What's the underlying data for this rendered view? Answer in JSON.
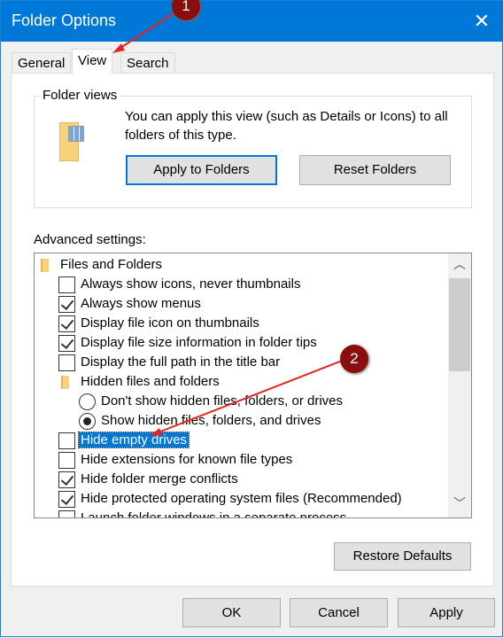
{
  "window": {
    "title": "Folder Options",
    "close_icon": "close-icon"
  },
  "tabs": [
    {
      "label": "General"
    },
    {
      "label": "View",
      "active": true
    },
    {
      "label": "Search"
    }
  ],
  "folder_views": {
    "label": "Folder views",
    "description": "You can apply this view (such as Details or Icons) to all folders of this type.",
    "apply_button": "Apply to Folders",
    "reset_button": "Reset Folders"
  },
  "advanced": {
    "label": "Advanced settings:",
    "items": [
      {
        "type": "folder",
        "label": "Files and Folders",
        "level": 0
      },
      {
        "type": "checkbox",
        "label": "Always show icons, never thumbnails",
        "checked": false
      },
      {
        "type": "checkbox",
        "label": "Always show menus",
        "checked": true
      },
      {
        "type": "checkbox",
        "label": "Display file icon on thumbnails",
        "checked": true
      },
      {
        "type": "checkbox",
        "label": "Display file size information in folder tips",
        "checked": true
      },
      {
        "type": "checkbox",
        "label": "Display the full path in the title bar",
        "checked": false
      },
      {
        "type": "folder",
        "label": "Hidden files and folders",
        "level": 1
      },
      {
        "type": "radio",
        "label": "Don't show hidden files, folders, or drives",
        "checked": false
      },
      {
        "type": "radio",
        "label": "Show hidden files, folders, and drives",
        "checked": true
      },
      {
        "type": "checkbox",
        "label": "Hide empty drives",
        "checked": false,
        "selected": true
      },
      {
        "type": "checkbox",
        "label": "Hide extensions for known file types",
        "checked": false
      },
      {
        "type": "checkbox",
        "label": "Hide folder merge conflicts",
        "checked": true
      },
      {
        "type": "checkbox",
        "label": "Hide protected operating system files (Recommended)",
        "checked": true
      },
      {
        "type": "checkbox",
        "label": "Launch folder windows in a separate process",
        "checked": false
      }
    ]
  },
  "restore_button": "Restore Defaults",
  "footer": {
    "ok": "OK",
    "cancel": "Cancel",
    "apply": "Apply"
  },
  "annotations": [
    {
      "label": "1"
    },
    {
      "label": "2"
    }
  ],
  "colors": {
    "accent": "#0078d7",
    "badge": "#8b0d0d",
    "arrow": "#e8221f"
  }
}
